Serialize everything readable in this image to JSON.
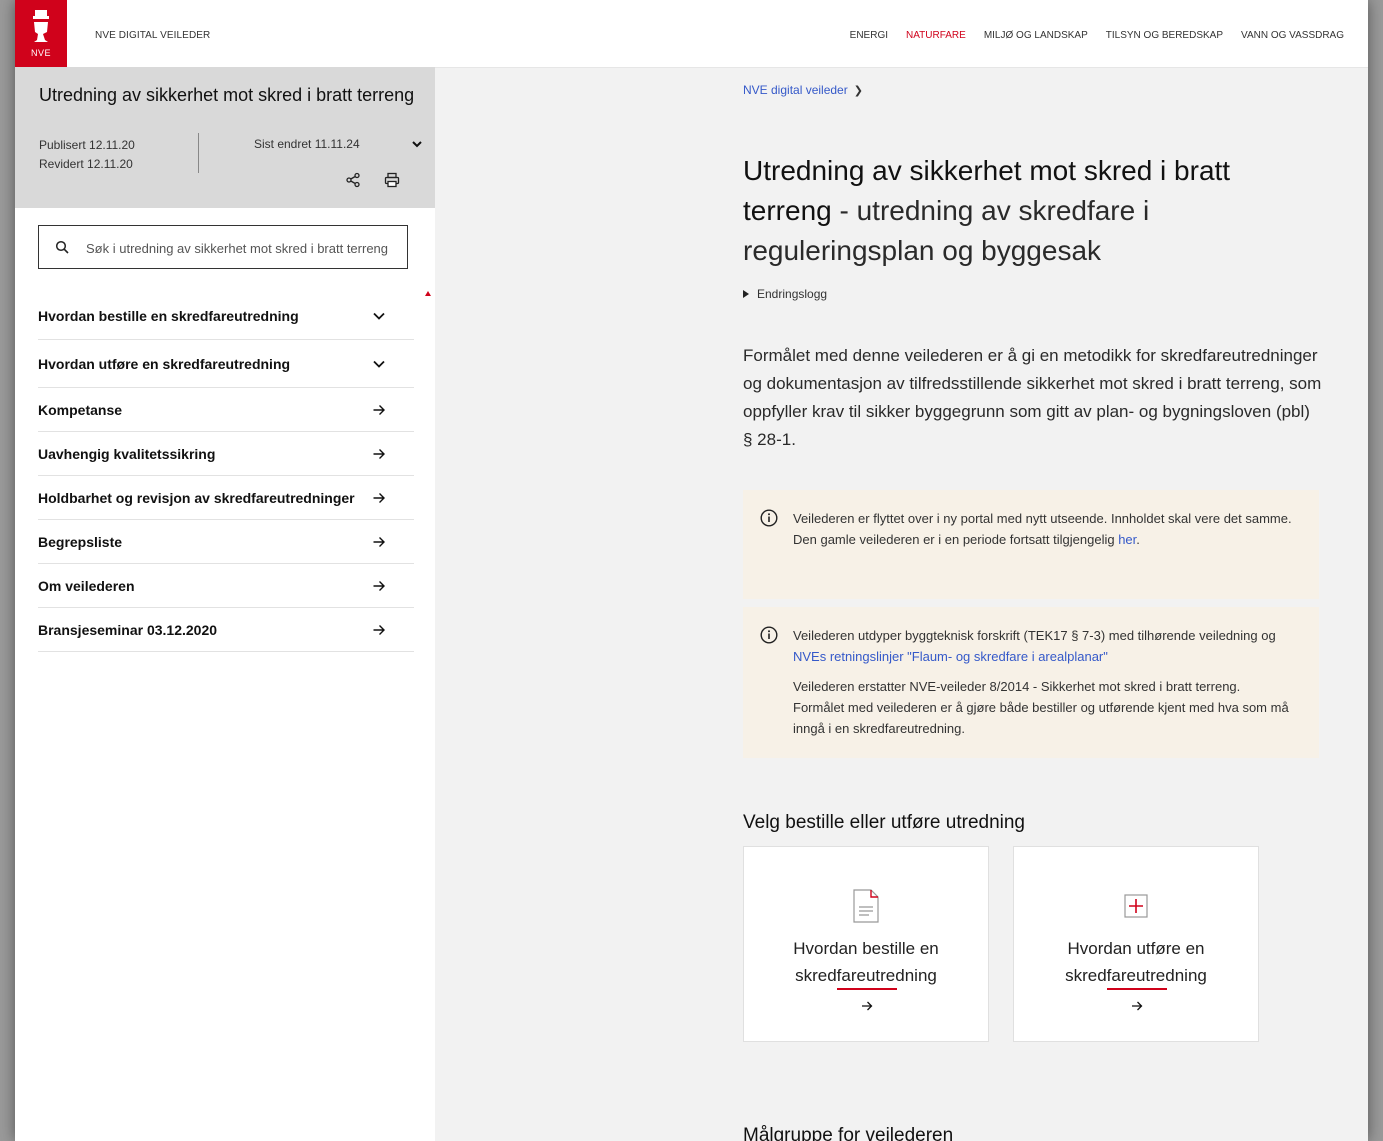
{
  "header": {
    "logo_text": "NVE",
    "site_name": "NVE DIGITAL VEILEDER",
    "nav": [
      {
        "label": "ENERGI",
        "active": false
      },
      {
        "label": "NATURFARE",
        "active": true
      },
      {
        "label": "MILJØ OG LANDSKAP",
        "active": false
      },
      {
        "label": "TILSYN OG BEREDSKAP",
        "active": false
      },
      {
        "label": "VANN OG VASSDRAG",
        "active": false
      }
    ]
  },
  "sidebar": {
    "title": "Utredning av sikkerhet mot skred i bratt terreng",
    "published": "Publisert 12.11.20",
    "revised": "Revidert 12.11.20",
    "last_changed": "Sist endret 11.11.24",
    "search_placeholder": "Søk i utredning av sikkerhet mot skred i bratt terreng",
    "items": [
      {
        "label": "Hvordan bestille en skredfareutredning",
        "icon": "chevron-down-icon"
      },
      {
        "label": "Hvordan utføre en skredfareutredning",
        "icon": "chevron-down-icon"
      },
      {
        "label": "Kompetanse",
        "icon": "arrow-right-icon"
      },
      {
        "label": "Uavhengig kvalitetssikring",
        "icon": "arrow-right-icon"
      },
      {
        "label": "Holdbarhet og revisjon av skredfareutredninger",
        "icon": "arrow-right-icon"
      },
      {
        "label": "Begrepsliste",
        "icon": "arrow-right-icon"
      },
      {
        "label": "Om veilederen",
        "icon": "arrow-right-icon"
      },
      {
        "label": "Bransjeseminar 03.12.2020",
        "icon": "arrow-right-icon"
      }
    ]
  },
  "main": {
    "breadcrumb": "NVE digital veileder",
    "title_main": "Utredning av sikkerhet mot skred i bratt terreng",
    "title_sub": " - utredning av skredfare i reguleringsplan og byggesak",
    "changelog": "Endringslogg",
    "lead": "Formålet med denne veilederen er å gi en metodikk for skredfareutredninger og dokumentasjon av tilfredsstillende sikkerhet mot skred i bratt terreng, som oppfyller krav til sikker byggegrunn som gitt av plan- og bygningsloven (pbl) § 28-1.",
    "notice1": {
      "text": "Veilederen er flyttet over i ny portal med nytt utseende. Innholdet skal vere det samme. Den gamle veilederen er i en periode fortsatt tilgjengelig ",
      "link": "her",
      "after": "."
    },
    "notice2": {
      "text": "Veilederen utdyper byggteknisk forskrift (TEK17 § 7-3) med tilhørende veiledning og ",
      "link": "NVEs retningslinjer \"Flaum- og skredfare i arealplanar\"",
      "para2": "Veilederen erstatter NVE-veileder 8/2014 - Sikkerhet mot skred i bratt terreng. Formålet med veilederen er å gjøre både bestiller og utførende kjent med hva som må inngå i en skredfareutredning."
    },
    "section_heading": "Velg bestille eller utføre utredning",
    "cards": [
      {
        "label": "Hvordan bestille en skredfareutredning",
        "icon": "document-icon"
      },
      {
        "label": "Hvordan utføre en skredfareutredning",
        "icon": "plus-square-icon"
      }
    ],
    "section_heading2": "Målgruppe for veilederen"
  },
  "colors": {
    "brand": "#d0021b",
    "link": "#3559c9",
    "notice_bg": "#f7f1e7",
    "sidebar_head_bg": "#d9d9d9"
  }
}
